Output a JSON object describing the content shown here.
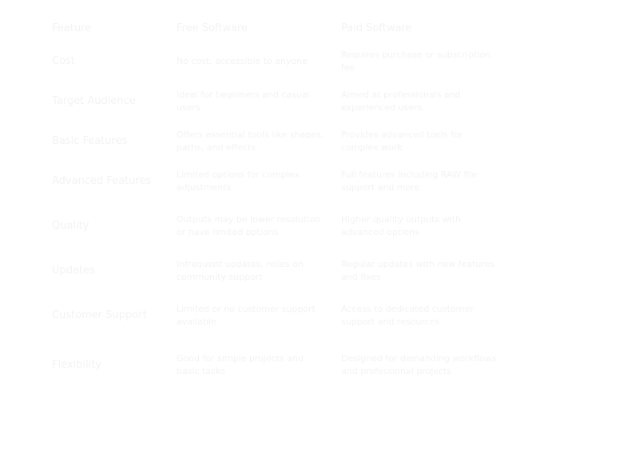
{
  "table": {
    "headers": [
      "Feature",
      "Free Software",
      "Paid Software"
    ],
    "rows": [
      {
        "feature": "Cost",
        "free": "No cost, accessible to anyone",
        "paid": "Requires purchase or subscription fee"
      },
      {
        "feature": "Target Audience",
        "free": "Ideal for beginners and casual users",
        "paid": "Aimed at professionals and experienced users"
      },
      {
        "feature": "Basic Features",
        "free": "Offers essential tools like shapes, paths, and effects",
        "paid": "Provides advanced tools for complex work"
      },
      {
        "feature": "Advanced Features",
        "free": "Limited options for complex adjustments",
        "paid": "Full features including RAW file support and more"
      },
      {
        "feature": "Quality",
        "free": "Outputs may be lower resolution or have limited options",
        "paid": "Higher quality outputs with advanced options"
      },
      {
        "feature": "Updates",
        "free": "Infrequent updates, relies on community support",
        "paid": "Regular updates with new features and fixes"
      },
      {
        "feature": "Customer Support",
        "free": "Limited or no customer support available",
        "paid": "Access to dedicated customer support and resources"
      },
      {
        "feature": "Flexibility",
        "free": "Good for simple projects and basic tasks",
        "paid": "Designed for demanding workflows and professional projects"
      }
    ]
  }
}
